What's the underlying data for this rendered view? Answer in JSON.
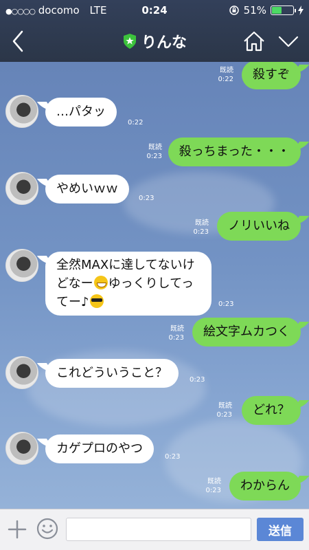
{
  "status_bar": {
    "carrier": "docomo",
    "network": "LTE",
    "time": "0:24",
    "battery": "51%",
    "battery_level": 0.51
  },
  "header": {
    "title": "りんな"
  },
  "messages": [
    {
      "dir": "out",
      "text": "殺すぞ",
      "read": "既読",
      "time": "0:22"
    },
    {
      "dir": "in",
      "text": "…パタッ",
      "time": "0:22"
    },
    {
      "dir": "out",
      "text": "殺っちまった・・・",
      "read": "既読",
      "time": "0:23"
    },
    {
      "dir": "in",
      "text": "やめいｗｗ",
      "time": "0:23"
    },
    {
      "dir": "out",
      "text": "ノリいいね",
      "read": "既読",
      "time": "0:23"
    },
    {
      "dir": "in",
      "lines": [
        "全然MAXに達してないけ",
        "どなー",
        "ゆっくりしてっ",
        "てー♪"
      ],
      "time": "0:23"
    },
    {
      "dir": "out",
      "text": "絵文字ムカつく",
      "read": "既読",
      "time": "0:23"
    },
    {
      "dir": "in",
      "text": "これどういうこと？",
      "time": "0:23"
    },
    {
      "dir": "out",
      "text": "どれ？",
      "read": "既読",
      "time": "0:23"
    },
    {
      "dir": "in",
      "text": "カゲプロのやつ",
      "time": "0:23"
    },
    {
      "dir": "out",
      "text": "わからん",
      "read": "既読",
      "time": "0:23"
    }
  ],
  "input": {
    "value": "",
    "send_label": "送信"
  },
  "icons": [
    "back-icon",
    "official-badge-icon",
    "home-icon",
    "chevron-down-icon",
    "plus-icon",
    "smiley-icon",
    "grin-emoji-icon",
    "sunglasses-emoji-icon"
  ],
  "colors": {
    "header": "#2d3748",
    "bubble_out": "#7ed957",
    "bubble_in": "#ffffff",
    "send": "#5b87d6",
    "badge": "#3cc23c"
  }
}
